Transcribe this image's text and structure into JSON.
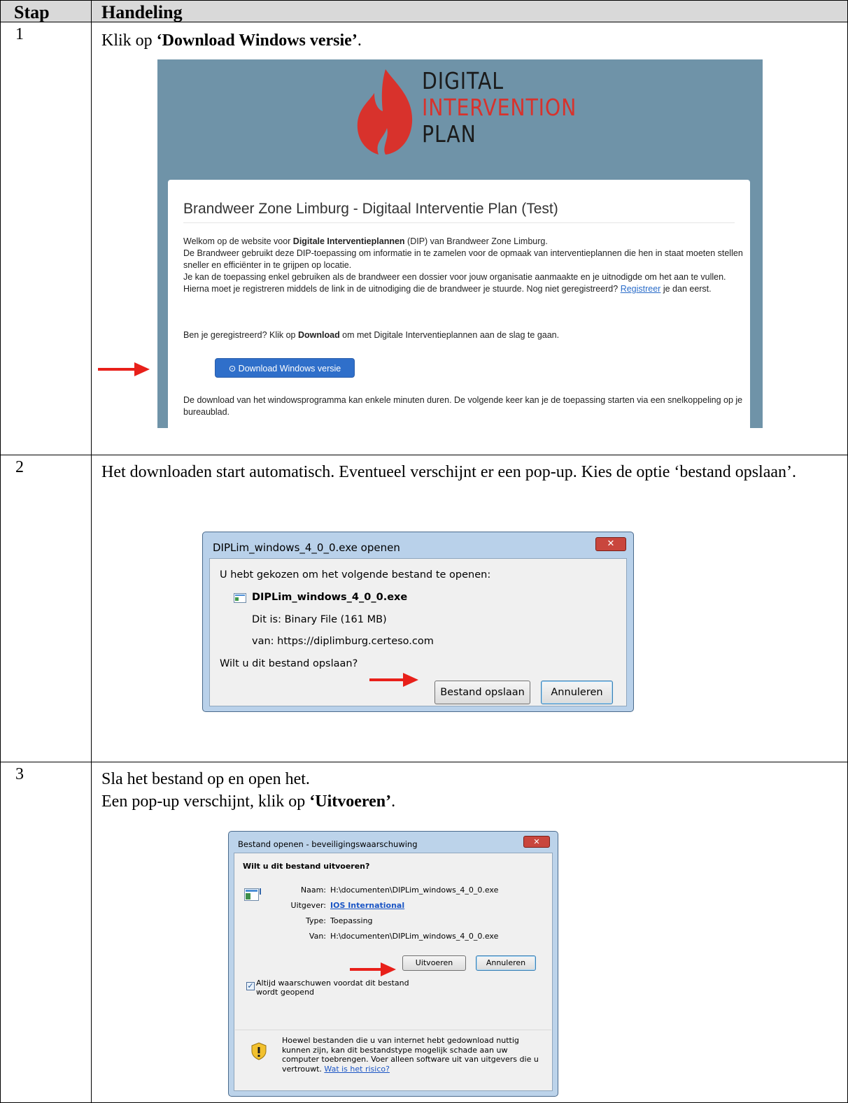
{
  "header": {
    "col1": "Stap",
    "col2": "Handeling"
  },
  "steps": [
    {
      "number": "1",
      "text_before": "Klik op ",
      "text_bold": "‘Download Windows versie’",
      "text_after": "."
    },
    {
      "number": "2",
      "text": "Het downloaden start automatisch. Eventueel verschijnt er een pop-up. Kies de optie ‘bestand opslaan’."
    },
    {
      "number": "3",
      "line1": "Sla het bestand op en open het.",
      "line2_before": "Een pop-up verschijnt, klik op ",
      "line2_bold": "‘Uitvoeren’",
      "line2_after": "."
    }
  ],
  "website": {
    "logo_line1": "DIGITAL",
    "logo_line2": "INTERVENTION",
    "logo_line3": "PLAN",
    "title": "Brandweer Zone Limburg - Digitaal Interventie Plan (Test)",
    "p1_a": "Welkom op de website voor ",
    "p1_b": "Digitale Interventieplannen",
    "p1_c": " (DIP) van Brandweer Zone Limburg.",
    "p2": "De Brandweer gebruikt deze DIP-toepassing om informatie in te zamelen voor de opmaak van interventieplannen die hen in staat moeten stellen sneller en efficiënter in te grijpen op locatie.",
    "p3": "Je kan de toepassing enkel gebruiken als de brandweer een dossier voor jouw organisatie aanmaakte en je uitnodigde om het aan te vullen. Hierna moet je registreren middels de link in de uitnodiging die de brandweer je stuurde. Nog niet geregistreerd?",
    "register_link": "Registreer",
    "p3_end": " je dan eerst.",
    "p4_a": "Ben je geregistreerd? Klik op ",
    "p4_b": "Download",
    "p4_c": " om met Digitale Interventieplannen aan de slag te gaan.",
    "download_button": "⊙ Download Windows versie",
    "p5": "De download van het windowsprogramma kan enkele minuten duren. De volgende keer kan je de toepassing starten via een snelkoppeling op je bureaublad."
  },
  "dialog_open": {
    "title": "DIPLim_windows_4_0_0.exe openen",
    "close": "✕",
    "intro": "U hebt gekozen om het volgende bestand te openen:",
    "filename": "DIPLim_windows_4_0_0.exe",
    "type_label": "Dit is:",
    "type_value": "Binary File (161 MB)",
    "from_label": "van:",
    "from_value": "https://diplimburg.certeso.com",
    "question": "Wilt u dit bestand opslaan?",
    "save_button": "Bestand opslaan",
    "cancel_button": "Annuleren"
  },
  "dialog_security": {
    "title": "Bestand openen - beveiligingswaarschuwing",
    "close": "✕",
    "question": "Wilt u dit bestand uitvoeren?",
    "name_label": "Naam:",
    "name_value": "H:\\documenten\\DIPLim_windows_4_0_0.exe",
    "publisher_label": "Uitgever:",
    "publisher_value": "IOS International",
    "type_label": "Type:",
    "type_value": "Toepassing",
    "from_label": "Van:",
    "from_value": "H:\\documenten\\DIPLim_windows_4_0_0.exe",
    "run_button": "Uitvoeren",
    "cancel_button": "Annuleren",
    "checkbox_mark": "✓",
    "checkbox_line1": "Altijd waarschuwen voordat dit bestand",
    "checkbox_line2": "wordt geopend",
    "warn_line1": "Hoewel bestanden die u van internet hebt gedownload nuttig",
    "warn_line2": "kunnen zijn, kan dit bestandstype mogelijk schade aan uw",
    "warn_line3": "computer toebrengen. Voer alleen software uit van uitgevers die u",
    "warn_line4a": "vertrouwt. ",
    "risk_link": "Wat is het risico?",
    "shield_mark": "!"
  },
  "colors": {
    "header_bg": "#d9d9d9",
    "arrow": "#e8201a",
    "website_bg": "#6f93a8",
    "logo_red": "#d8322c",
    "button_blue": "#2f6fca"
  }
}
